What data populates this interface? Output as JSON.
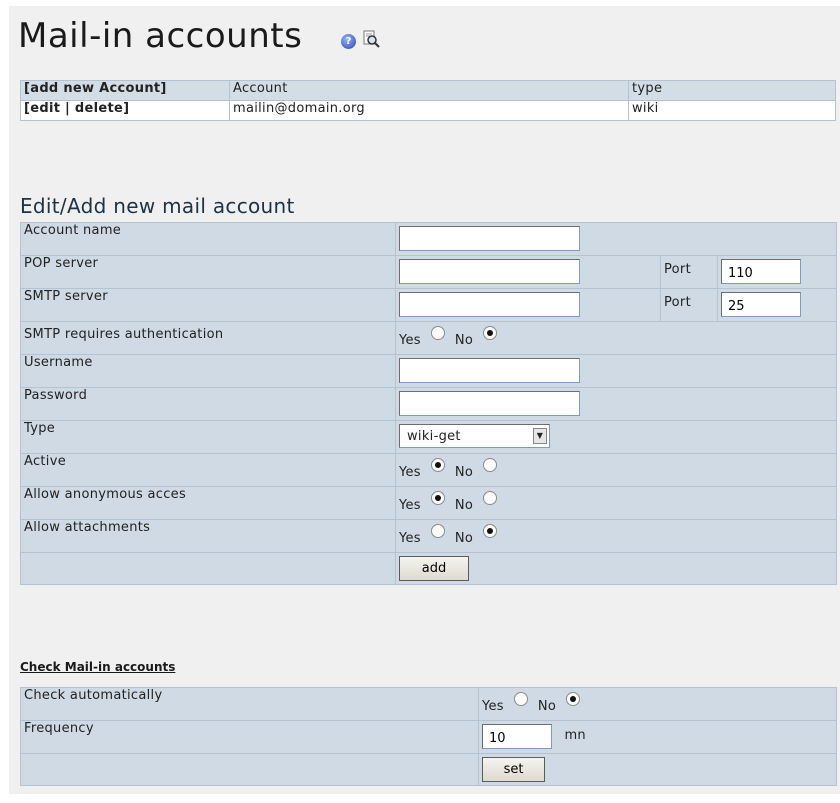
{
  "header": {
    "title": "Mail-in accounts"
  },
  "accounts_table": {
    "columns": [
      "[add new Account]",
      "Account",
      "type"
    ],
    "rows": [
      {
        "actions": "[edit | delete]",
        "account": "mailin@domain.org",
        "type": "wiki"
      }
    ]
  },
  "form": {
    "heading": "Edit/Add new mail account",
    "fields": {
      "account_name": {
        "label": "Account name",
        "value": ""
      },
      "pop_server": {
        "label": "POP server",
        "value": "",
        "port_label": "Port",
        "port_value": "110"
      },
      "smtp_server": {
        "label": "SMTP server",
        "value": "",
        "port_label": "Port",
        "port_value": "25"
      },
      "smtp_auth": {
        "label": "SMTP requires authentication",
        "yes": "Yes",
        "no": "No",
        "selected": "No"
      },
      "username": {
        "label": "Username",
        "value": ""
      },
      "password": {
        "label": "Password",
        "value": ""
      },
      "type": {
        "label": "Type",
        "selected": "wiki-get"
      },
      "active": {
        "label": "Active",
        "yes": "Yes",
        "no": "No",
        "selected": "Yes"
      },
      "anonymous": {
        "label": "Allow anonymous acces",
        "yes": "Yes",
        "no": "No",
        "selected": "Yes"
      },
      "attachments": {
        "label": "Allow attachments",
        "yes": "Yes",
        "no": "No",
        "selected": "No"
      }
    },
    "add_button": "add"
  },
  "check": {
    "link": "Check Mail-in accounts",
    "auto": {
      "label": "Check automatically",
      "yes": "Yes",
      "no": "No",
      "selected": "No"
    },
    "frequency": {
      "label": "Frequency",
      "value": "10",
      "unit": "mn"
    },
    "set_button": "set"
  }
}
